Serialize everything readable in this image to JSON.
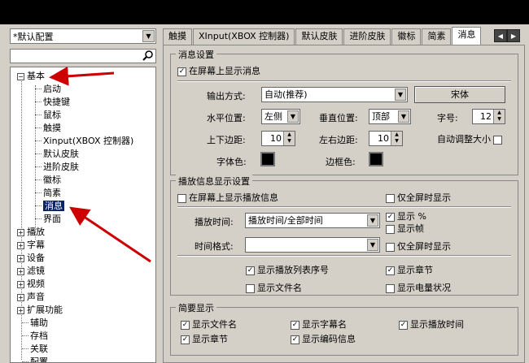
{
  "window": {
    "bg": "#d4d0c8",
    "selection": "#0a246a",
    "arrow_color": "#cc0000"
  },
  "left": {
    "preset": "*默认配置",
    "search_placeholder": "",
    "tree": {
      "basic": "基本",
      "children": [
        "启动",
        "快捷键",
        "鼠标",
        "触摸",
        "Xinput(XBOX 控制器)",
        "默认皮肤",
        "进阶皮肤",
        "徽标",
        "简素",
        "消息",
        "界面"
      ],
      "selected_child": "消息",
      "roots": [
        "播放",
        "字幕",
        "设备",
        "滤镜",
        "视频",
        "声音",
        "扩展功能"
      ],
      "leaves": [
        "辅助",
        "存档",
        "关联",
        "配置"
      ]
    }
  },
  "tabs": {
    "items": [
      "触摸",
      "XInput(XBOX 控制器)",
      "默认皮肤",
      "进阶皮肤",
      "徽标",
      "简素",
      "消息"
    ],
    "active": "消息"
  },
  "msg_settings": {
    "title": "消息设置",
    "show_msg": "在屏幕上显示消息",
    "output_label": "输出方式:",
    "output_value": "自动(推荐)",
    "font_button": "宋体",
    "hpos_label": "水平位置:",
    "hpos_value": "左侧",
    "vpos_label": "垂直位置:",
    "vpos_value": "顶部",
    "size_label": "字号:",
    "size_value": "12",
    "tb_margin_label": "上下边距:",
    "tb_margin_value": "10",
    "lr_margin_label": "左右边距:",
    "lr_margin_value": "10",
    "auto_size": "自动调整大小",
    "font_color_label": "字体色:",
    "border_color_label": "边框色:"
  },
  "play_info": {
    "title": "播放信息显示设置",
    "show_play_info": "在屏幕上显示播放信息",
    "fullscreen_only_1": "仅全屏时显示",
    "time_label": "播放时间:",
    "time_value": "播放时间/全部时间",
    "show_percent": "显示 %",
    "show_frames": "显示帧",
    "format_label": "时间格式:",
    "format_value": "",
    "fullscreen_only_2": "仅全屏时显示",
    "show_list_index": "显示播放列表序号",
    "show_chapter": "显示章节",
    "show_filename": "显示文件名",
    "show_battery": "显示电量状况"
  },
  "brief": {
    "title": "简要显示",
    "items": [
      "显示文件名",
      "显示字幕名",
      "显示播放时间",
      "显示章节",
      "显示编码信息"
    ]
  }
}
